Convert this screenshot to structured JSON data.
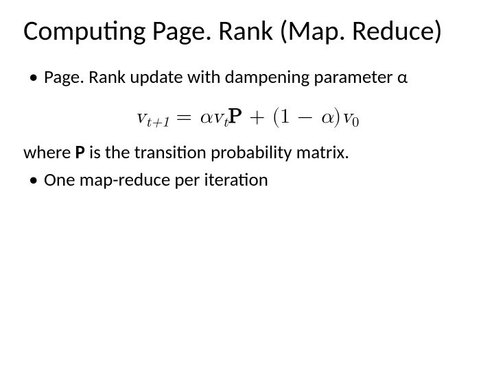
{
  "title": "Computing Page. Rank (Map. Reduce)",
  "bullet1_a": "Page. Rank update with dampening parameter ",
  "bullet1_b": "α",
  "eq": {
    "v": "v",
    "t1": "t+1",
    "eq": " = ",
    "alpha": "α",
    "t": "t",
    "P": "P",
    "plus": " + (1 − ",
    "alpha2": "α",
    "close": ")",
    "zero": "0"
  },
  "line_where_a": "where ",
  "line_where_P": "P",
  "line_where_b": " is the transition probability matrix.",
  "bullet2": "One map-reduce per iteration"
}
